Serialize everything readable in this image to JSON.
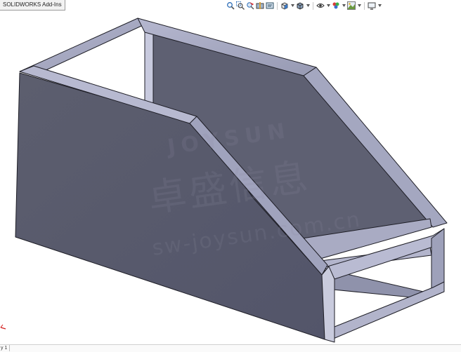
{
  "toolbar": {
    "tab_label": "SOLIDWORKS Add-Ins",
    "icons": [
      "zoom-to-fit-icon",
      "zoom-to-area-icon",
      "previous-view-icon",
      "section-view-icon",
      "dynamic-annotation-icon",
      "view-orientation-icon",
      "display-style-icon",
      "hide-show-icon",
      "edit-appearance-icon",
      "apply-scene-icon",
      "view-settings-icon"
    ]
  },
  "viewport": {
    "model": "rectangular tube frame with sheet panels",
    "panel_color": "#5a5c6c",
    "frame_color": "#a2a4bd",
    "background": "#ffffff"
  },
  "watermark": {
    "line1": "JOYSUN",
    "line2": "卓盛信息",
    "line3": "sw-joysun.com.cn"
  },
  "status": {
    "tab_label": "y 1"
  }
}
